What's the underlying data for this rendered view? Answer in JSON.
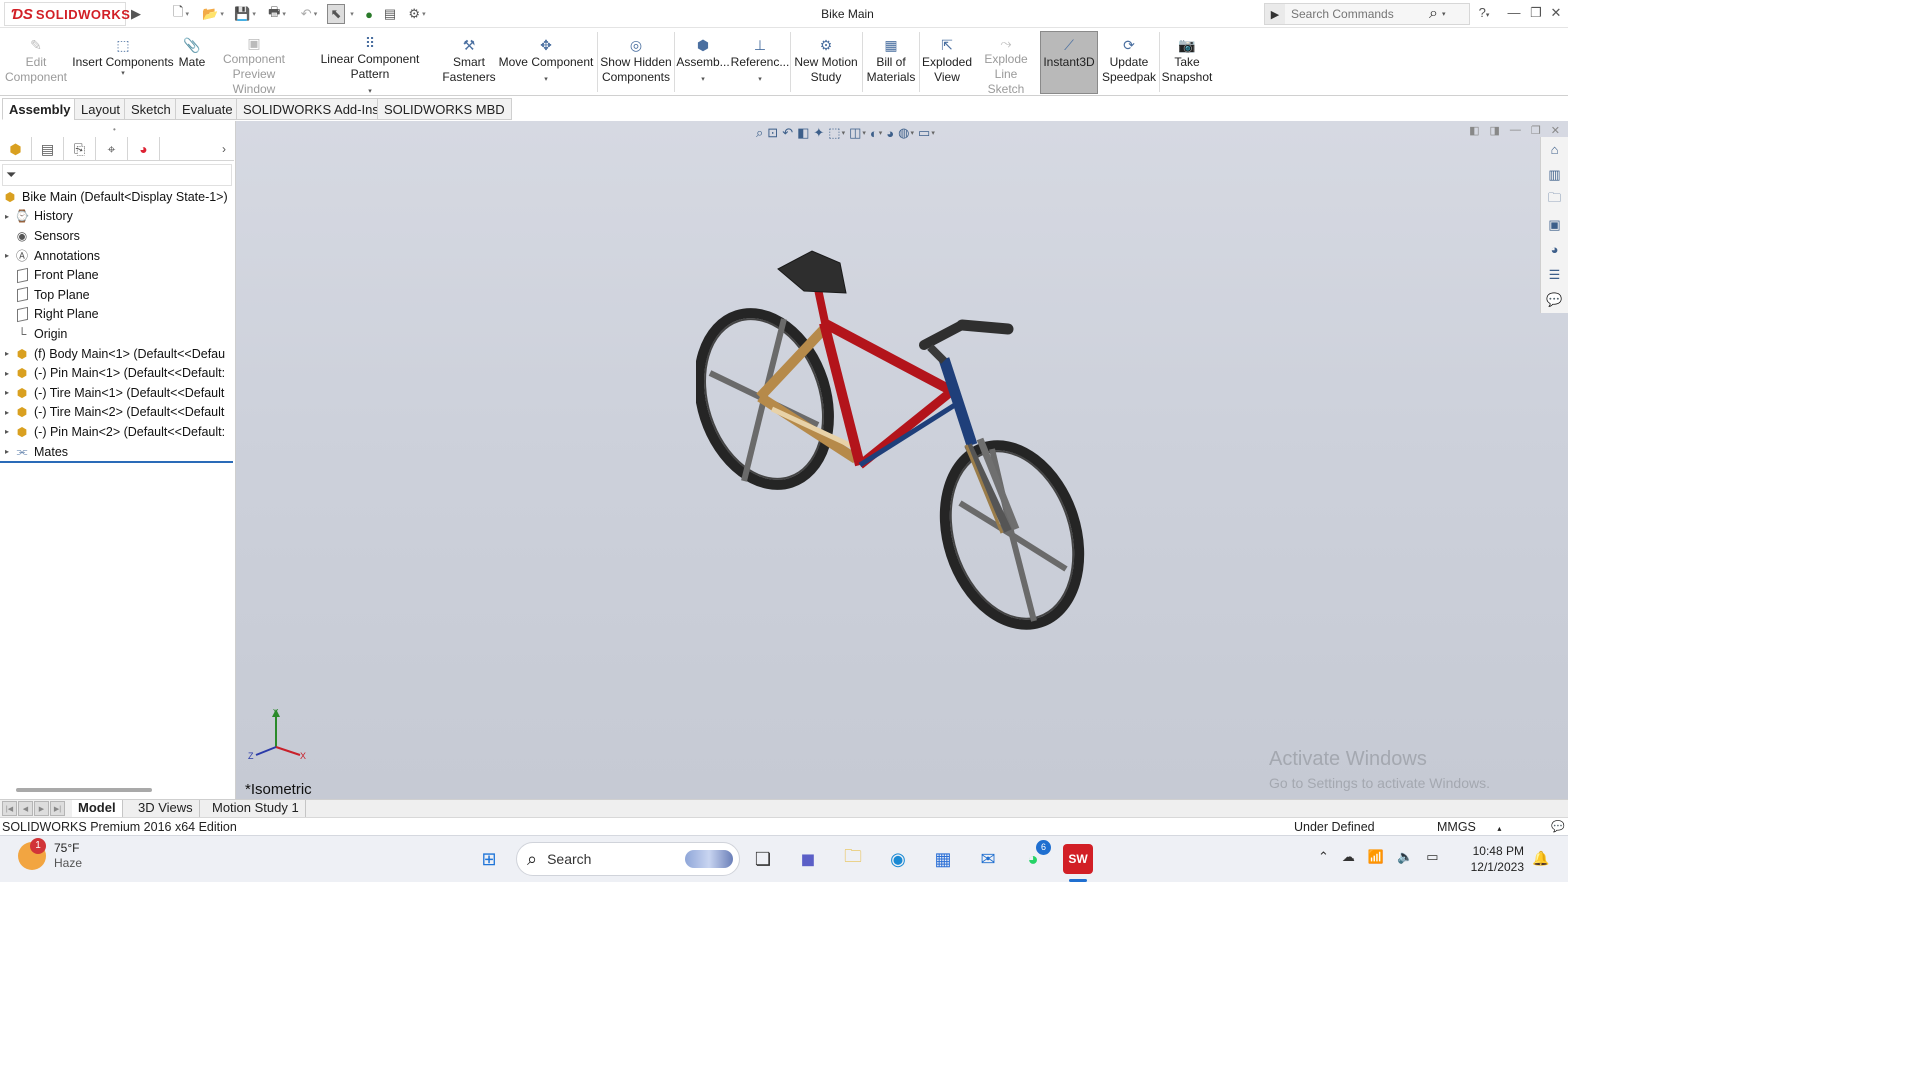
{
  "app": {
    "logo_text": "SOLIDWORKS",
    "document_title": "Bike Main",
    "search_placeholder": "Search Commands",
    "help_icon": "?"
  },
  "ribbon": {
    "buttons": [
      {
        "label": "Edit Component",
        "enabled": false
      },
      {
        "label": "Insert Components",
        "enabled": true
      },
      {
        "label": "Mate",
        "enabled": true
      },
      {
        "label": "Component Preview Window",
        "enabled": false
      },
      {
        "label": "Linear Component Pattern",
        "enabled": true
      },
      {
        "label": "Smart Fasteners",
        "enabled": true
      },
      {
        "label": "Move Component",
        "enabled": true
      },
      {
        "label": "Show Hidden Components",
        "enabled": true
      },
      {
        "label": "Assemb...",
        "enabled": true
      },
      {
        "label": "Referenc...",
        "enabled": true
      },
      {
        "label": "New Motion Study",
        "enabled": true
      },
      {
        "label": "Bill of Materials",
        "enabled": true
      },
      {
        "label": "Exploded View",
        "enabled": true
      },
      {
        "label": "Explode Line Sketch",
        "enabled": false
      },
      {
        "label": "Instant3D",
        "enabled": true,
        "active": true
      },
      {
        "label": "Update Speedpak",
        "enabled": true
      },
      {
        "label": "Take Snapshot",
        "enabled": true
      }
    ]
  },
  "tabs": [
    "Assembly",
    "Layout",
    "Sketch",
    "Evaluate",
    "SOLIDWORKS Add-Ins",
    "SOLIDWORKS MBD"
  ],
  "active_tab": "Assembly",
  "feature_tree": {
    "root": "Bike Main  (Default<Display State-1>)",
    "items": [
      {
        "label": "History",
        "expandable": true,
        "icon": "history-icon"
      },
      {
        "label": "Sensors",
        "expandable": false,
        "icon": "sensor-icon"
      },
      {
        "label": "Annotations",
        "expandable": true,
        "icon": "annotation-icon"
      },
      {
        "label": "Front Plane",
        "expandable": false,
        "icon": "plane-icon"
      },
      {
        "label": "Top Plane",
        "expandable": false,
        "icon": "plane-icon"
      },
      {
        "label": "Right Plane",
        "expandable": false,
        "icon": "plane-icon"
      },
      {
        "label": "Origin",
        "expandable": false,
        "icon": "origin-icon"
      },
      {
        "label": "(f) Body Main<1> (Default<<Defau",
        "expandable": true,
        "icon": "component-icon"
      },
      {
        "label": "(-) Pin Main<1> (Default<<Default:",
        "expandable": true,
        "icon": "component-icon"
      },
      {
        "label": "(-) Tire Main<1> (Default<<Default",
        "expandable": true,
        "icon": "component-icon"
      },
      {
        "label": "(-) Tire Main<2> (Default<<Default",
        "expandable": true,
        "icon": "component-icon"
      },
      {
        "label": "(-) Pin Main<2> (Default<<Default:",
        "expandable": true,
        "icon": "component-icon"
      },
      {
        "label": "Mates",
        "expandable": true,
        "icon": "mates-icon"
      }
    ]
  },
  "viewport": {
    "view_name": "*Isometric",
    "watermark_title": "Activate Windows",
    "watermark_sub": "Go to Settings to activate Windows.",
    "triad": {
      "x": "X",
      "y": "Y",
      "z": "Z"
    },
    "colors": {
      "frame_red": "#b3141b",
      "frame_blue": "#1f3f7a",
      "frame_tan": "#b68a4a",
      "wheel": "#2a2a2a",
      "background": "#cdd1db"
    }
  },
  "bottom_tabs": [
    "Model",
    "3D Views",
    "Motion Study 1"
  ],
  "active_bottom_tab": "Model",
  "status": {
    "edition": "SOLIDWORKS Premium 2016 x64 Edition",
    "state": "Under Defined",
    "units": "MMGS"
  },
  "taskbar": {
    "weather_temp": "75°F",
    "weather_desc": "Haze",
    "weather_badge": "1",
    "search_label": "Search",
    "whatsapp_badge": "6",
    "time": "10:48 PM",
    "date": "12/1/2023"
  }
}
